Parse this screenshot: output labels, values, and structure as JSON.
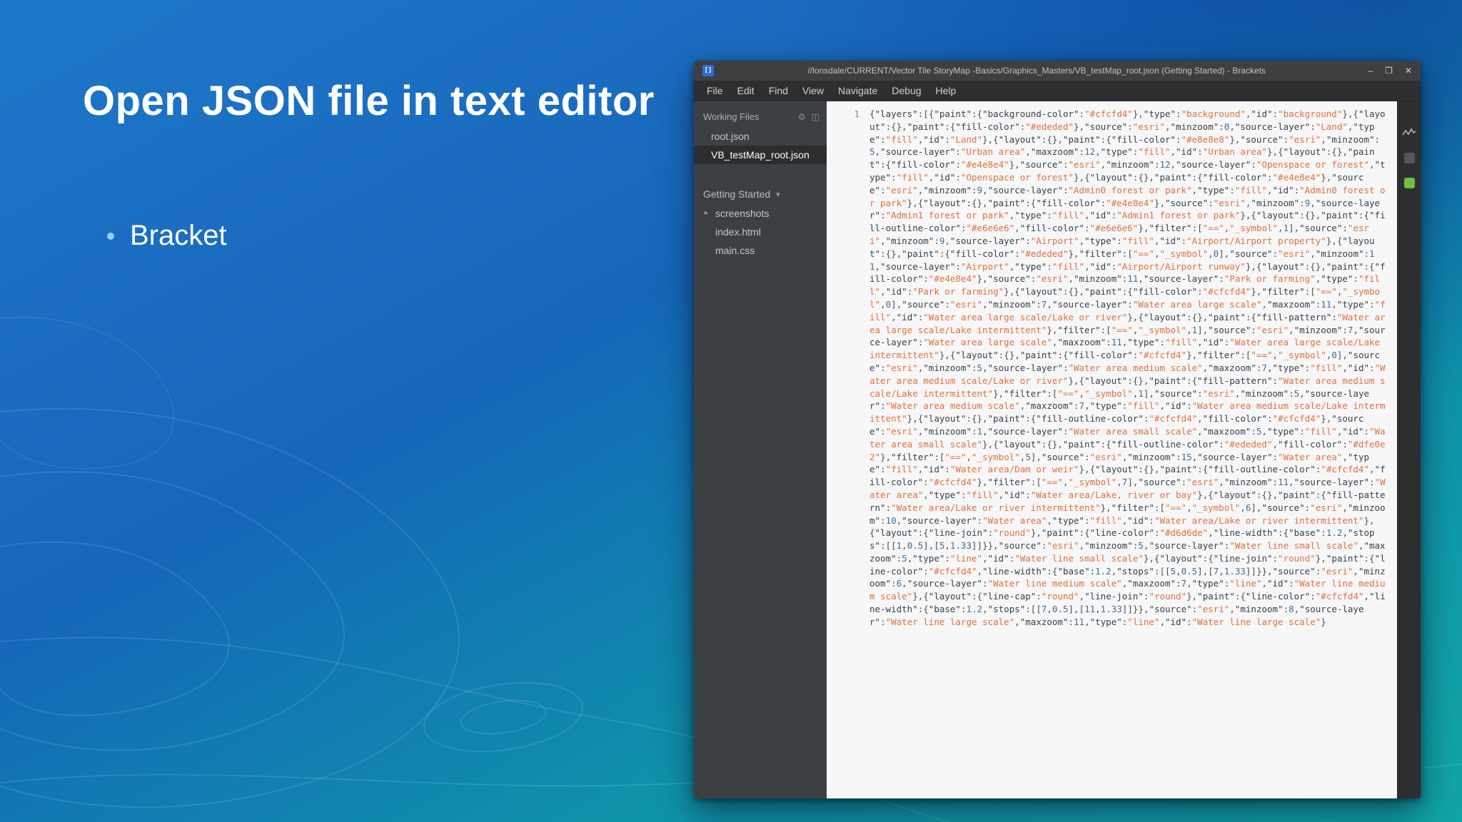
{
  "slide": {
    "title": "Open JSON file in text editor",
    "bullet": "Bracket"
  },
  "editor": {
    "window_title": "//lonsdale/CURRENT/Vector Tile StoryMap -Basics/Graphics_Masters/VB_testMap_root.json (Getting Started) - Brackets",
    "menu": [
      "File",
      "Edit",
      "Find",
      "View",
      "Navigate",
      "Debug",
      "Help"
    ],
    "sidebar": {
      "working_files_label": "Working Files",
      "working_files": [
        "root.json",
        "VB_testMap_root.json"
      ],
      "selected_file": "VB_testMap_root.json",
      "project_label": "Getting Started",
      "project_files": [
        "screenshots",
        "index.html",
        "main.css"
      ]
    },
    "gutter": {
      "line_number": "1"
    },
    "code": "{\"layers\":[{\"paint\":{\"background-color\":\"#cfcfd4\"},\"type\":\"background\",\"id\":\"background\"},{\"layout\":{},\"paint\":{\"fill-color\":\"#ededed\"},\"source\":\"esri\",\"minzoom\":0,\"source-layer\":\"Land\",\"type\":\"fill\",\"id\":\"Land\"},{\"layout\":{},\"paint\":{\"fill-color\":\"#e8e8e8\"},\"source\":\"esri\",\"minzoom\":5,\"source-layer\":\"Urban area\",\"maxzoom\":12,\"type\":\"fill\",\"id\":\"Urban area\"},{\"layout\":{},\"paint\":{\"fill-color\":\"#e4e8e4\"},\"source\":\"esri\",\"minzoom\":12,\"source-layer\":\"Openspace or forest\",\"type\":\"fill\",\"id\":\"Openspace or forest\"},{\"layout\":{},\"paint\":{\"fill-color\":\"#e4e8e4\"},\"source\":\"esri\",\"minzoom\":9,\"source-layer\":\"Admin0 forest or park\",\"type\":\"fill\",\"id\":\"Admin0 forest or park\"},{\"layout\":{},\"paint\":{\"fill-color\":\"#e4e8e4\"},\"source\":\"esri\",\"minzoom\":9,\"source-layer\":\"Admin1 forest or park\",\"type\":\"fill\",\"id\":\"Admin1 forest or park\"},{\"layout\":{},\"paint\":{\"fill-outline-color\":\"#e6e6e6\",\"fill-color\":\"#e6e6e6\"},\"filter\":[\"==\",\"_symbol\",1],\"source\":\"esri\",\"minzoom\":9,\"source-layer\":\"Airport\",\"type\":\"fill\",\"id\":\"Airport/Airport property\"},{\"layout\":{},\"paint\":{\"fill-color\":\"#ededed\"},\"filter\":[\"==\",\"_symbol\",0],\"source\":\"esri\",\"minzoom\":11,\"source-layer\":\"Airport\",\"type\":\"fill\",\"id\":\"Airport/Airport runway\"},{\"layout\":{},\"paint\":{\"fill-color\":\"#e4e8e4\"},\"source\":\"esri\",\"minzoom\":11,\"source-layer\":\"Park or farming\",\"type\":\"fill\",\"id\":\"Park or farming\"},{\"layout\":{},\"paint\":{\"fill-color\":\"#cfcfd4\"},\"filter\":[\"==\",\"_symbol\",0],\"source\":\"esri\",\"minzoom\":7,\"source-layer\":\"Water area large scale\",\"maxzoom\":11,\"type\":\"fill\",\"id\":\"Water area large scale/Lake or river\"},{\"layout\":{},\"paint\":{\"fill-pattern\":\"Water area large scale/Lake intermittent\"},\"filter\":[\"==\",\"_symbol\",1],\"source\":\"esri\",\"minzoom\":7,\"source-layer\":\"Water area large scale\",\"maxzoom\":11,\"type\":\"fill\",\"id\":\"Water area large scale/Lake intermittent\"},{\"layout\":{},\"paint\":{\"fill-color\":\"#cfcfd4\"},\"filter\":[\"==\",\"_symbol\",0],\"source\":\"esri\",\"minzoom\":5,\"source-layer\":\"Water area medium scale\",\"maxzoom\":7,\"type\":\"fill\",\"id\":\"Water area medium scale/Lake or river\"},{\"layout\":{},\"paint\":{\"fill-pattern\":\"Water area medium scale/Lake intermittent\"},\"filter\":[\"==\",\"_symbol\",1],\"source\":\"esri\",\"minzoom\":5,\"source-layer\":\"Water area medium scale\",\"maxzoom\":7,\"type\":\"fill\",\"id\":\"Water area medium scale/Lake intermittent\"},{\"layout\":{},\"paint\":{\"fill-outline-color\":\"#cfcfd4\",\"fill-color\":\"#cfcfd4\"},\"source\":\"esri\",\"minzoom\":1,\"source-layer\":\"Water area small scale\",\"maxzoom\":5,\"type\":\"fill\",\"id\":\"Water area small scale\"},{\"layout\":{},\"paint\":{\"fill-outline-color\":\"#ededed\",\"fill-color\":\"#dfe0e2\"},\"filter\":[\"==\",\"_symbol\",5],\"source\":\"esri\",\"minzoom\":15,\"source-layer\":\"Water area\",\"type\":\"fill\",\"id\":\"Water area/Dam or weir\"},{\"layout\":{},\"paint\":{\"fill-outline-color\":\"#cfcfd4\",\"fill-color\":\"#cfcfd4\"},\"filter\":[\"==\",\"_symbol\",7],\"source\":\"esri\",\"minzoom\":11,\"source-layer\":\"Water area\",\"type\":\"fill\",\"id\":\"Water area/Lake, river or bay\"},{\"layout\":{},\"paint\":{\"fill-pattern\":\"Water area/Lake or river intermittent\"},\"filter\":[\"==\",\"_symbol\",6],\"source\":\"esri\",\"minzoom\":10,\"source-layer\":\"Water area\",\"type\":\"fill\",\"id\":\"Water area/Lake or river intermittent\"},{\"layout\":{\"line-join\":\"round\"},\"paint\":{\"line-color\":\"#d6d6de\",\"line-width\":{\"base\":1.2,\"stops\":[[1,0.5],[5,1.33]]}},\"source\":\"esri\",\"minzoom\":5,\"source-layer\":\"Water line small scale\",\"maxzoom\":5,\"type\":\"line\",\"id\":\"Water line small scale\"},{\"layout\":{\"line-join\":\"round\"},\"paint\":{\"line-color\":\"#cfcfd4\",\"line-width\":{\"base\":1.2,\"stops\":[[5,0.5],[7,1.33]]}},\"source\":\"esri\",\"minzoom\":6,\"source-layer\":\"Water line medium scale\",\"maxzoom\":7,\"type\":\"line\",\"id\":\"Water line medium scale\"},{\"layout\":{\"line-cap\":\"round\",\"line-join\":\"round\"},\"paint\":{\"line-color\":\"#cfcfd4\",\"line-width\":{\"base\":1.2,\"stops\":[[7,0.5],[11,1.33]]}},\"source\":\"esri\",\"minzoom\":8,\"source-layer\":\"Water line large scale\",\"maxzoom\":11,\"type\":\"line\",\"id\":\"Water line large scale\"}"
  },
  "icons": {
    "logo": "[]",
    "minimize": "–",
    "maximize": "❐",
    "close": "✕",
    "gear": "⚙",
    "split": "◫",
    "caret_down": "▾",
    "caret_right": "▸"
  },
  "colors": {
    "slide_blue": "#1a6cc0",
    "slide_teal": "#11a6a6",
    "string_orange": "#e0703c",
    "sidebar_gray": "#3c4043",
    "extension_green": "#6cbf3f"
  }
}
